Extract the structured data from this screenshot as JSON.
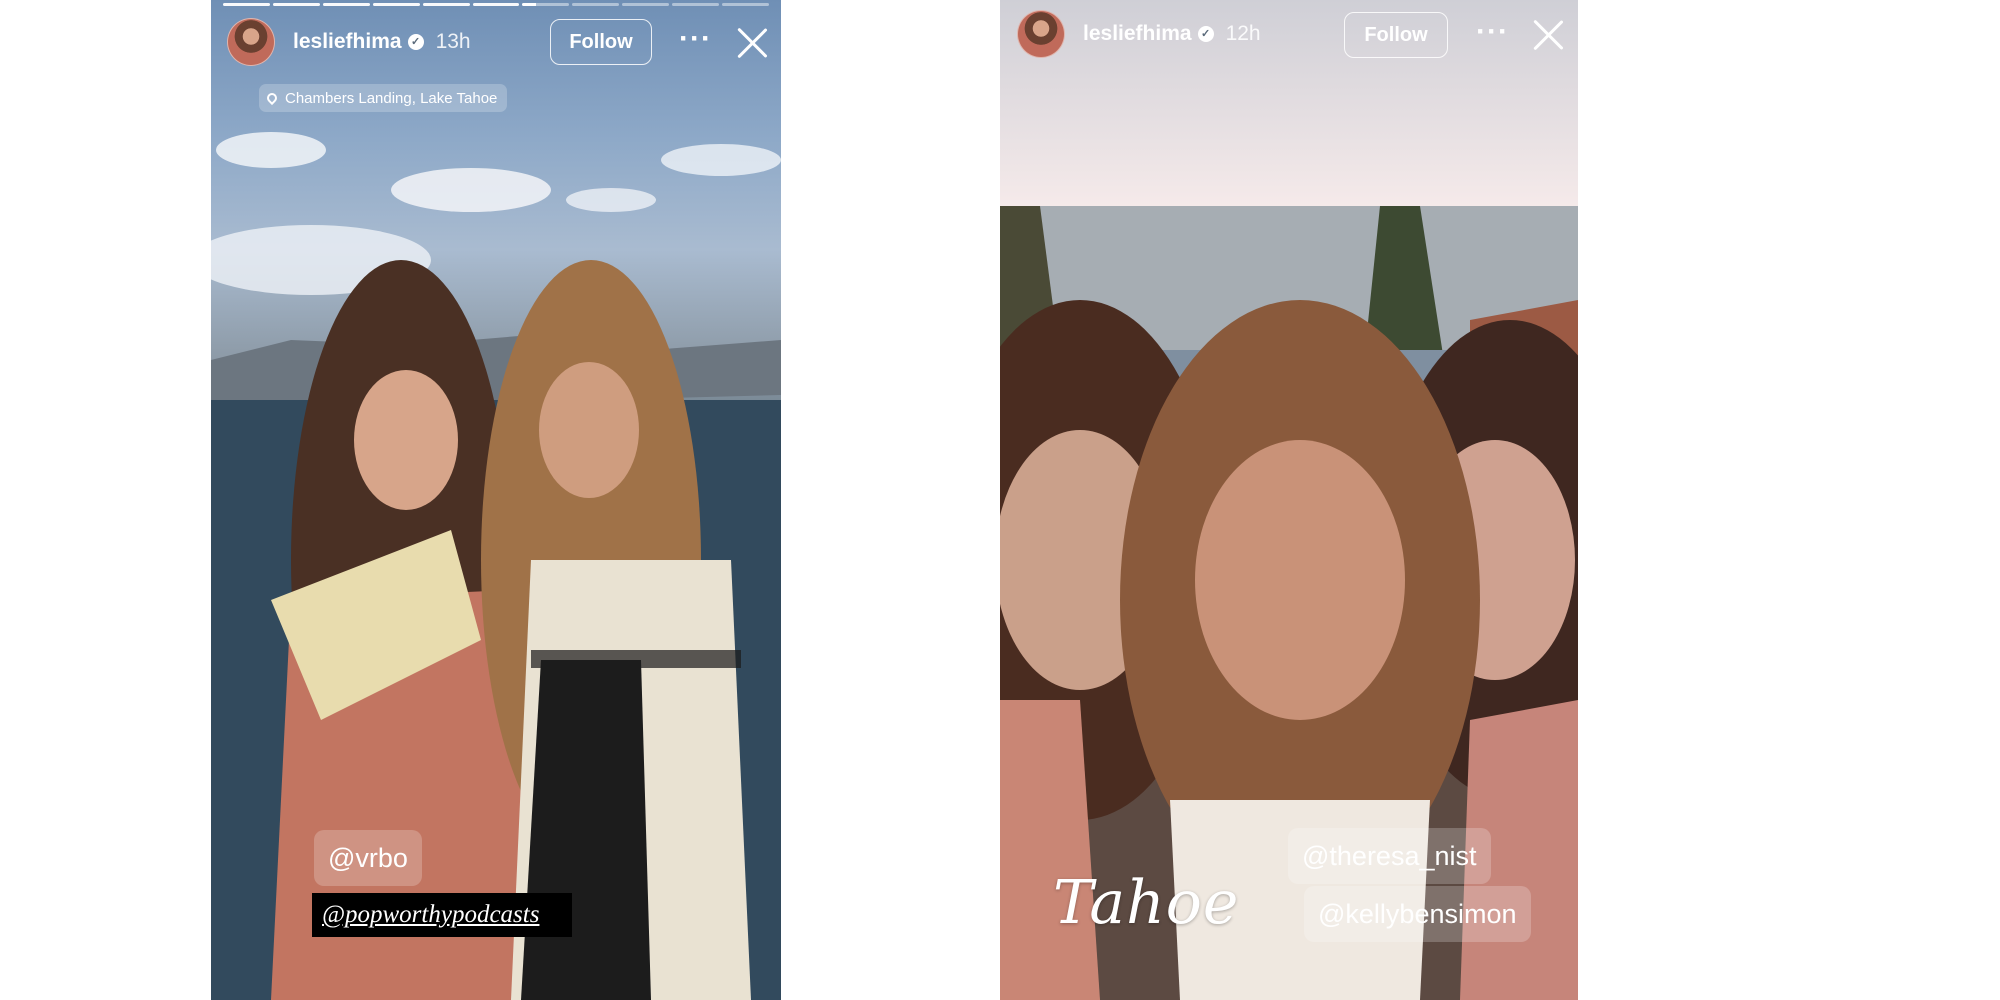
{
  "left_story": {
    "username": "lesliefhima",
    "time_ago": "13h",
    "follow_label": "Follow",
    "more_label": "···",
    "location": "Chambers Landing, Lake Tahoe",
    "tags": [
      "@vrbo",
      "@popworthypodcasts"
    ],
    "progress": {
      "segments": 11,
      "completed": 6,
      "current_fraction": 0.3
    },
    "icons": {
      "verified": "verified-badge-icon",
      "more": "more-options-icon",
      "close": "close-icon",
      "location": "location-pin-icon"
    }
  },
  "right_story": {
    "username": "lesliefhima",
    "time_ago": "12h",
    "follow_label": "Follow",
    "more_label": "···",
    "caption": "Tahoe",
    "tags": [
      "@theresa_nist",
      "@kellybensimon"
    ],
    "icons": {
      "verified": "verified-badge-icon",
      "more": "more-options-icon",
      "close": "close-icon"
    }
  },
  "colors": {
    "text": "#ffffff",
    "tag_background": "rgba(255,255,255,0.22)",
    "dark_tag_background": "#000000"
  }
}
